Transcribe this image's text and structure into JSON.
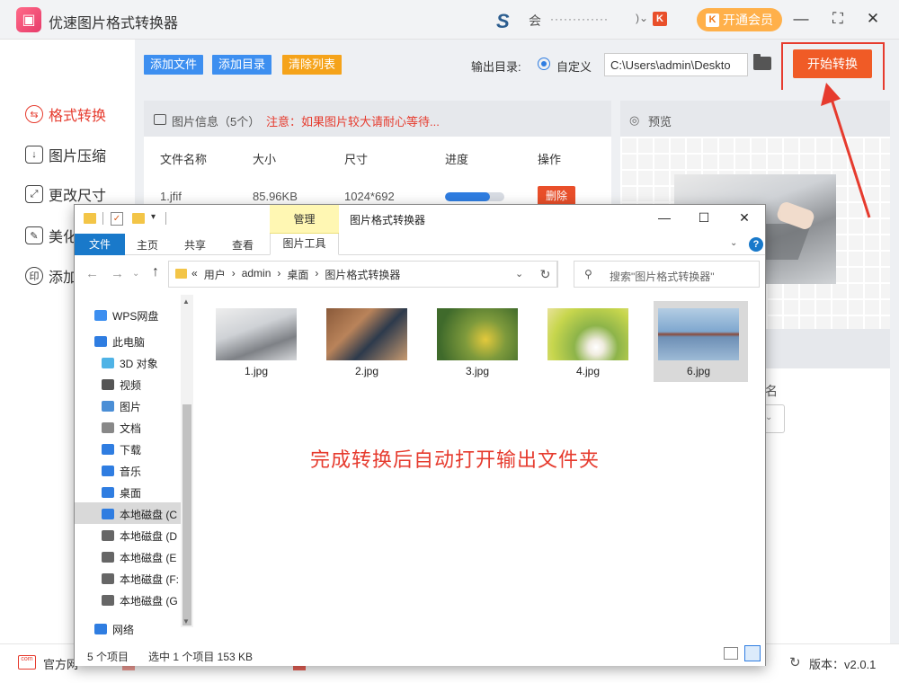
{
  "app": {
    "title": "优速图片格式转换器",
    "logo_icon": "app-logo-icon",
    "user": {
      "name": "会",
      "masked_text": "·············",
      "chevron": ")⌄",
      "vip_mini_badge": "K"
    },
    "vip_button": {
      "icon": "K",
      "label": "开通会员"
    },
    "window_controls": {
      "minimize": "—",
      "maximize": "⛶",
      "close": "✕"
    }
  },
  "nav": {
    "items": [
      {
        "label": "格式转换",
        "icon": "⇆",
        "active": true
      },
      {
        "label": "图片压缩",
        "icon": "↓",
        "active": false
      },
      {
        "label": "更改尺寸",
        "icon": "⤢",
        "active": false
      },
      {
        "label": "美化",
        "icon": "✎",
        "active": false
      },
      {
        "label": "添加",
        "icon": "印",
        "active": false
      }
    ]
  },
  "toolbar": {
    "add_file": "添加文件",
    "add_dir": "添加目录",
    "clear_list": "清除列表",
    "output_label": "输出目录:",
    "radio_custom": "自定义",
    "output_path": "C:\\Users\\admin\\Deskto",
    "start_button": "开始转换"
  },
  "info": {
    "title": "图片信息（5个）",
    "warning": "注意：如果图片较大请耐心等待..."
  },
  "table": {
    "columns": [
      "文件名称",
      "大小",
      "尺寸",
      "进度",
      "操作"
    ],
    "rows": [
      {
        "name": "1.jfif",
        "size": "85.96KB",
        "dimensions": "1024*692",
        "progress": 0.75,
        "action": "删除"
      }
    ]
  },
  "preview": {
    "label": "预览",
    "eye_icon": "◎"
  },
  "settings_partial": {
    "label": "名",
    "select_arrow": "⌄"
  },
  "footer": {
    "site_icon": "com",
    "site_label": "官方网",
    "version": "版本：v2.0.1",
    "refresh_icon": "↻"
  },
  "explorer": {
    "title": "图片格式转换器",
    "manage_tab": "管理",
    "tabs": {
      "file": "文件",
      "home": "主页",
      "share": "共享",
      "view": "查看",
      "picture_tools": "图片工具"
    },
    "address": {
      "prefix": "«",
      "parts": [
        "用户",
        "admin",
        "桌面",
        "图片格式转换器"
      ],
      "sep": "›"
    },
    "search_placeholder": "搜索\"图片格式转换器\"",
    "nav_items": [
      {
        "label": "WPS网盘",
        "icon": "cloud-icon",
        "color": "#3d8ff0"
      },
      {
        "label": "此电脑",
        "icon": "computer-icon",
        "color": "#2f7de1"
      },
      {
        "label": "3D 对象",
        "icon": "cube-icon",
        "color": "#4fb3e6"
      },
      {
        "label": "视频",
        "icon": "film-icon",
        "color": "#555555"
      },
      {
        "label": "图片",
        "icon": "picture-icon",
        "color": "#4a8ed6"
      },
      {
        "label": "文档",
        "icon": "document-icon",
        "color": "#888888"
      },
      {
        "label": "下载",
        "icon": "download-icon",
        "color": "#2f7de1"
      },
      {
        "label": "音乐",
        "icon": "music-icon",
        "color": "#2f7de1"
      },
      {
        "label": "桌面",
        "icon": "desktop-icon",
        "color": "#2f7de1"
      },
      {
        "label": "本地磁盘 (C",
        "icon": "drive-c-icon",
        "color": "#2f7de1"
      },
      {
        "label": "本地磁盘 (D",
        "icon": "drive-icon",
        "color": "#666666"
      },
      {
        "label": "本地磁盘 (E",
        "icon": "drive-icon",
        "color": "#666666"
      },
      {
        "label": "本地磁盘 (F:",
        "icon": "drive-icon",
        "color": "#666666"
      },
      {
        "label": "本地磁盘 (G",
        "icon": "drive-icon",
        "color": "#666666"
      },
      {
        "label": "网络",
        "icon": "network-icon",
        "color": "#2f7de1"
      }
    ],
    "files": [
      {
        "name": "1.jpg",
        "selected": false
      },
      {
        "name": "2.jpg",
        "selected": false
      },
      {
        "name": "3.jpg",
        "selected": false
      },
      {
        "name": "4.jpg",
        "selected": false
      },
      {
        "name": "6.jpg",
        "selected": true
      }
    ],
    "overlay_text": "完成转换后自动打开输出文件夹",
    "status": {
      "count": "5 个项目",
      "selection": "选中 1 个项目 153 KB"
    }
  },
  "colors": {
    "accent_red": "#e63b2e",
    "accent_blue": "#3d8ff0",
    "start_orange": "#f05b26",
    "clear_orange": "#f5a31a"
  }
}
